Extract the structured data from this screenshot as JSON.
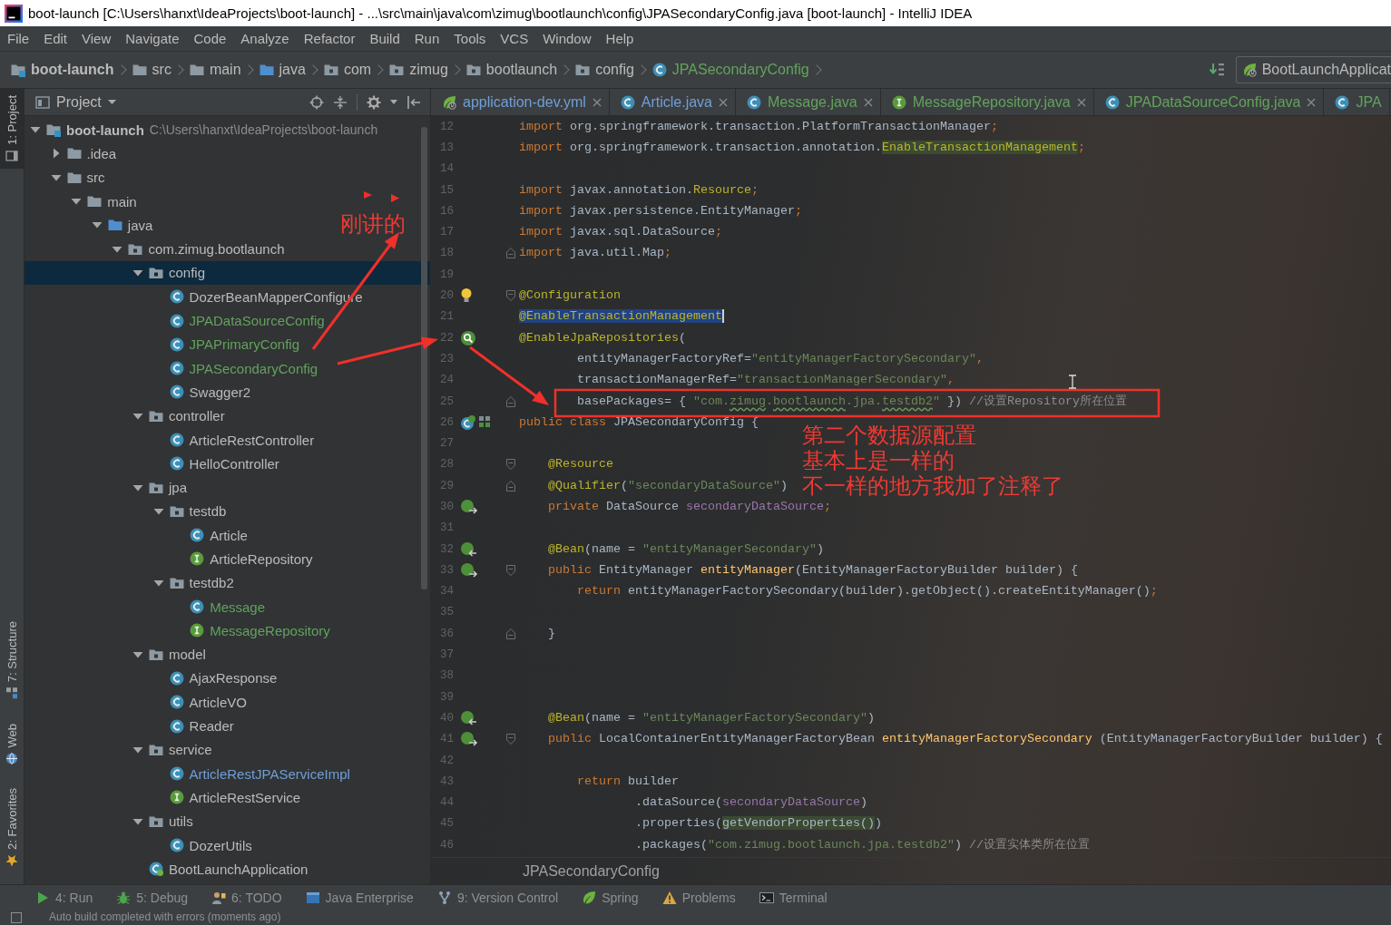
{
  "window": {
    "title": "boot-launch [C:\\Users\\hanxt\\IdeaProjects\\boot-launch] - ...\\src\\main\\java\\com\\zimug\\bootlaunch\\config\\JPASecondaryConfig.java [boot-launch] - IntelliJ IDEA"
  },
  "menu": [
    "File",
    "Edit",
    "View",
    "Navigate",
    "Code",
    "Analyze",
    "Refactor",
    "Build",
    "Run",
    "Tools",
    "VCS",
    "Window",
    "Help"
  ],
  "navigation_bar": {
    "crumbs": [
      {
        "kind": "module",
        "label": "boot-launch"
      },
      {
        "kind": "folder",
        "label": "src"
      },
      {
        "kind": "folder",
        "label": "main"
      },
      {
        "kind": "source-folder",
        "label": "java"
      },
      {
        "kind": "package",
        "label": "com"
      },
      {
        "kind": "package",
        "label": "zimug"
      },
      {
        "kind": "package",
        "label": "bootlaunch"
      },
      {
        "kind": "package",
        "label": "config"
      },
      {
        "kind": "class",
        "label": "JPASecondaryConfig",
        "color": "#62a35c"
      }
    ],
    "run_configuration": "BootLaunchApplicat"
  },
  "tool_strip": {
    "top": [
      {
        "kind": "project",
        "label": "1: Project",
        "selected": true
      }
    ],
    "bottom": [
      {
        "kind": "structure",
        "label": "7: Structure",
        "selected": false
      },
      {
        "kind": "web",
        "label": "Web",
        "selected": false
      },
      {
        "kind": "favorites",
        "label": "2: Favorites",
        "selected": false
      }
    ]
  },
  "project_panel": {
    "title": "Project",
    "tree": [
      {
        "kind": "module",
        "label": "boot-launch",
        "path": "C:\\Users\\hanxt\\IdeaProjects\\boot-launch",
        "expanded": true,
        "selected": false,
        "children": [
          {
            "kind": "folder",
            "label": ".idea",
            "expanded": false,
            "selected": false
          },
          {
            "kind": "folder",
            "label": "src",
            "expanded": true,
            "selected": false,
            "children": [
              {
                "kind": "folder",
                "label": "main",
                "expanded": true,
                "selected": false,
                "children": [
                  {
                    "kind": "source-folder",
                    "label": "java",
                    "expanded": true,
                    "selected": false,
                    "children": [
                      {
                        "kind": "package",
                        "label": "com.zimug.bootlaunch",
                        "expanded": true,
                        "selected": false,
                        "children": [
                          {
                            "kind": "package",
                            "label": "config",
                            "expanded": true,
                            "selected": true,
                            "children": [
                              {
                                "kind": "class",
                                "label": "DozerBeanMapperConfigure",
                                "color": "#bbbbbb",
                                "selected": false
                              },
                              {
                                "kind": "class",
                                "label": "JPADataSourceConfig",
                                "color": "#62a35c",
                                "selected": false
                              },
                              {
                                "kind": "class",
                                "label": "JPAPrimaryConfig",
                                "color": "#62a35c",
                                "selected": false
                              },
                              {
                                "kind": "class",
                                "label": "JPASecondaryConfig",
                                "color": "#62a35c",
                                "selected": false
                              },
                              {
                                "kind": "class",
                                "label": "Swagger2",
                                "color": "#bbbbbb",
                                "selected": false
                              }
                            ]
                          },
                          {
                            "kind": "package",
                            "label": "controller",
                            "expanded": true,
                            "selected": false,
                            "children": [
                              {
                                "kind": "class",
                                "label": "ArticleRestController",
                                "color": "#bbbbbb",
                                "selected": false
                              },
                              {
                                "kind": "class",
                                "label": "HelloController",
                                "color": "#bbbbbb",
                                "selected": false
                              }
                            ]
                          },
                          {
                            "kind": "package",
                            "label": "jpa",
                            "expanded": true,
                            "selected": false,
                            "children": [
                              {
                                "kind": "package",
                                "label": "testdb",
                                "expanded": true,
                                "selected": false,
                                "children": [
                                  {
                                    "kind": "class",
                                    "label": "Article",
                                    "color": "#bbbbbb",
                                    "selected": false
                                  },
                                  {
                                    "kind": "interface",
                                    "label": "ArticleRepository",
                                    "color": "#bbbbbb",
                                    "selected": false
                                  }
                                ]
                              },
                              {
                                "kind": "package",
                                "label": "testdb2",
                                "expanded": true,
                                "selected": false,
                                "children": [
                                  {
                                    "kind": "class",
                                    "label": "Message",
                                    "color": "#62a35c",
                                    "selected": false
                                  },
                                  {
                                    "kind": "interface",
                                    "label": "MessageRepository",
                                    "color": "#62a35c",
                                    "selected": false
                                  }
                                ]
                              }
                            ]
                          },
                          {
                            "kind": "package",
                            "label": "model",
                            "expanded": true,
                            "selected": false,
                            "children": [
                              {
                                "kind": "class",
                                "label": "AjaxResponse",
                                "color": "#bbbbbb",
                                "selected": false
                              },
                              {
                                "kind": "class",
                                "label": "ArticleVO",
                                "color": "#bbbbbb",
                                "selected": false
                              },
                              {
                                "kind": "class",
                                "label": "Reader",
                                "color": "#bbbbbb",
                                "selected": false
                              }
                            ]
                          },
                          {
                            "kind": "package",
                            "label": "service",
                            "expanded": true,
                            "selected": false,
                            "children": [
                              {
                                "kind": "class",
                                "label": "ArticleRestJPAServiceImpl",
                                "color": "#6f9fd8",
                                "selected": false
                              },
                              {
                                "kind": "interface",
                                "label": "ArticleRestService",
                                "color": "#bbbbbb",
                                "selected": false
                              }
                            ]
                          },
                          {
                            "kind": "package",
                            "label": "utils",
                            "expanded": true,
                            "selected": false,
                            "children": [
                              {
                                "kind": "class",
                                "label": "DozerUtils",
                                "color": "#bbbbbb",
                                "selected": false
                              }
                            ]
                          },
                          {
                            "kind": "boot-app",
                            "label": "BootLaunchApplication",
                            "color": "#bbbbbb",
                            "selected": false
                          }
                        ]
                      }
                    ]
                  }
                ]
              }
            ]
          }
        ]
      }
    ]
  },
  "editor": {
    "tabs": [
      {
        "kind": "yaml",
        "label": "application-dev.yml",
        "color": "#6f9fd8",
        "selected": false,
        "close_button": true
      },
      {
        "kind": "class",
        "label": "Article.java",
        "color": "#6f9fd8",
        "selected": false,
        "close_button": true
      },
      {
        "kind": "class",
        "label": "Message.java",
        "color": "#62a35c",
        "selected": false,
        "close_button": true
      },
      {
        "kind": "interface",
        "label": "MessageRepository.java",
        "color": "#62a35c",
        "selected": false,
        "close_button": true
      },
      {
        "kind": "class",
        "label": "JPADataSourceConfig.java",
        "color": "#62a35c",
        "selected": false,
        "close_button": true
      },
      {
        "kind": "class",
        "label": "JPA",
        "color": "#62a35c",
        "selected": false,
        "close_button": false
      }
    ],
    "lines": [
      {
        "number": "12",
        "tokens": [
          {
            "kind": "keyword",
            "text": "import "
          },
          {
            "kind": "plain",
            "text": "org.springframework.transaction.PlatformTransactionManager"
          },
          {
            "kind": "keyword",
            "text": ";"
          }
        ]
      },
      {
        "number": "13",
        "tokens": [
          {
            "kind": "keyword",
            "text": "import "
          },
          {
            "kind": "plain",
            "text": "org.springframework.transaction.annotation."
          },
          {
            "kind": "annotation",
            "text": "EnableTransactionManagement",
            "highlighted": true
          },
          {
            "kind": "keyword",
            "text": ";"
          }
        ]
      },
      {
        "number": "14"
      },
      {
        "number": "15",
        "tokens": [
          {
            "kind": "keyword",
            "text": "import "
          },
          {
            "kind": "plain",
            "text": "javax.annotation."
          },
          {
            "kind": "annotation",
            "text": "Resource"
          },
          {
            "kind": "keyword",
            "text": ";"
          }
        ]
      },
      {
        "number": "16",
        "tokens": [
          {
            "kind": "keyword",
            "text": "import "
          },
          {
            "kind": "plain",
            "text": "javax.persistence.EntityManager"
          },
          {
            "kind": "keyword",
            "text": ";"
          }
        ]
      },
      {
        "number": "17",
        "tokens": [
          {
            "kind": "keyword",
            "text": "import "
          },
          {
            "kind": "plain",
            "text": "javax.sql.DataSource"
          },
          {
            "kind": "keyword",
            "text": ";"
          }
        ]
      },
      {
        "number": "18",
        "fold_end": true,
        "tokens": [
          {
            "kind": "keyword",
            "text": "import "
          },
          {
            "kind": "plain",
            "text": "java.util.Map"
          },
          {
            "kind": "keyword",
            "text": ";"
          }
        ]
      },
      {
        "number": "19"
      },
      {
        "number": "20",
        "gutter_icon": {
          "kind": "bulb"
        },
        "fold_start": true,
        "tokens": [
          {
            "kind": "annotation",
            "text": "@Configuration"
          }
        ]
      },
      {
        "number": "21",
        "tokens": [
          {
            "kind": "annotation",
            "text": "@EnableTransactionManagement",
            "selected": true,
            "caret": true
          }
        ]
      },
      {
        "number": "22",
        "gutter_icon": {
          "kind": "bean-search"
        },
        "tokens": [
          {
            "kind": "annotation",
            "text": "@EnableJpaRepositories"
          },
          {
            "kind": "plain",
            "text": "("
          }
        ]
      },
      {
        "number": "23",
        "tokens": [
          {
            "kind": "plain",
            "text": "        entityManagerFactoryRef="
          },
          {
            "kind": "string",
            "text": "\"entityManagerFactorySecondary\""
          },
          {
            "kind": "keyword",
            "text": ","
          }
        ]
      },
      {
        "number": "24",
        "tokens": [
          {
            "kind": "plain",
            "text": "        transactionManagerRef="
          },
          {
            "kind": "string",
            "text": "\"transactionManagerSecondary\""
          },
          {
            "kind": "keyword",
            "text": ","
          }
        ]
      },
      {
        "number": "25",
        "fold_end": true,
        "tokens": [
          {
            "kind": "plain",
            "text": "        basePackages= { "
          },
          {
            "kind": "string",
            "text": "\"com."
          },
          {
            "kind": "string",
            "text": "zimug",
            "typo": true
          },
          {
            "kind": "string",
            "text": "."
          },
          {
            "kind": "string",
            "text": "bootlaunch",
            "typo": true
          },
          {
            "kind": "string",
            "text": ".jpa."
          },
          {
            "kind": "string",
            "text": "testdb2",
            "typo": true
          },
          {
            "kind": "string",
            "text": "\""
          },
          {
            "kind": "plain",
            "text": " }) "
          },
          {
            "kind": "comment",
            "text": "//设置Repository所在位置"
          }
        ]
      },
      {
        "number": "26",
        "gutter_icon": {
          "kind": "bean-class"
        },
        "tokens": [
          {
            "kind": "keyword",
            "text": "public class "
          },
          {
            "kind": "plain",
            "text": "JPASecondaryConfig {"
          }
        ]
      },
      {
        "number": "27"
      },
      {
        "number": "28",
        "fold_start": true,
        "tokens": [
          {
            "kind": "annotation",
            "text": "    @Resource"
          }
        ]
      },
      {
        "number": "29",
        "fold_end": true,
        "tokens": [
          {
            "kind": "annotation",
            "text": "    @Qualifier"
          },
          {
            "kind": "plain",
            "text": "("
          },
          {
            "kind": "string",
            "text": "\"secondaryDataSource\""
          },
          {
            "kind": "plain",
            "text": ")"
          }
        ]
      },
      {
        "number": "30",
        "gutter_icon": {
          "kind": "bean-out"
        },
        "tokens": [
          {
            "kind": "keyword",
            "text": "    private "
          },
          {
            "kind": "plain",
            "text": "DataSource "
          },
          {
            "kind": "field",
            "text": "secondaryDataSource"
          },
          {
            "kind": "keyword",
            "text": ";"
          }
        ]
      },
      {
        "number": "31"
      },
      {
        "number": "32",
        "gutter_icon": {
          "kind": "bean-in"
        },
        "tokens": [
          {
            "kind": "annotation",
            "text": "    @Bean"
          },
          {
            "kind": "plain",
            "text": "(name = "
          },
          {
            "kind": "string",
            "text": "\"entityManagerSecondary\""
          },
          {
            "kind": "plain",
            "text": ")"
          }
        ]
      },
      {
        "number": "33",
        "gutter_icon": {
          "kind": "bean-out"
        },
        "fold_start": true,
        "tokens": [
          {
            "kind": "keyword",
            "text": "    public "
          },
          {
            "kind": "plain",
            "text": "EntityManager "
          },
          {
            "kind": "method",
            "text": "entityManager"
          },
          {
            "kind": "plain",
            "text": "(EntityManagerFactoryBuilder builder) {"
          }
        ]
      },
      {
        "number": "34",
        "tokens": [
          {
            "kind": "keyword",
            "text": "        return "
          },
          {
            "kind": "plain",
            "text": "entityManagerFactorySecondary(builder).getObject().createEntityManager()"
          },
          {
            "kind": "keyword",
            "text": ";"
          }
        ]
      },
      {
        "number": "35"
      },
      {
        "number": "36",
        "fold_end": true,
        "tokens": [
          {
            "kind": "plain",
            "text": "    }"
          }
        ]
      },
      {
        "number": "37"
      },
      {
        "number": "38"
      },
      {
        "number": "39"
      },
      {
        "number": "40",
        "gutter_icon": {
          "kind": "bean-in"
        },
        "tokens": [
          {
            "kind": "annotation",
            "text": "    @Bean"
          },
          {
            "kind": "plain",
            "text": "(name = "
          },
          {
            "kind": "string",
            "text": "\"entityManagerFactorySecondary\""
          },
          {
            "kind": "plain",
            "text": ")"
          }
        ]
      },
      {
        "number": "41",
        "gutter_icon": {
          "kind": "bean-out"
        },
        "fold_start": true,
        "tokens": [
          {
            "kind": "keyword",
            "text": "    public "
          },
          {
            "kind": "plain",
            "text": "LocalContainerEntityManagerFactoryBean "
          },
          {
            "kind": "method",
            "text": "entityManagerFactorySecondary"
          },
          {
            "kind": "plain",
            "text": " (EntityManagerFactoryBuilder builder) {"
          }
        ]
      },
      {
        "number": "42"
      },
      {
        "number": "43",
        "tokens": [
          {
            "kind": "keyword",
            "text": "        return "
          },
          {
            "kind": "plain",
            "text": "builder"
          }
        ]
      },
      {
        "number": "44",
        "tokens": [
          {
            "kind": "plain",
            "text": "                .dataSource("
          },
          {
            "kind": "field",
            "text": "secondaryDataSource"
          },
          {
            "kind": "plain",
            "text": ")"
          }
        ]
      },
      {
        "number": "45",
        "tokens": [
          {
            "kind": "plain",
            "text": "                .properties("
          },
          {
            "kind": "plain",
            "text": "getVendorProperties()",
            "highlighted": true
          },
          {
            "kind": "plain",
            "text": ")"
          }
        ]
      },
      {
        "number": "46",
        "tokens": [
          {
            "kind": "plain",
            "text": "                .packages("
          },
          {
            "kind": "string",
            "text": "\"com.zimug.bootlaunch.jpa.testdb2\""
          },
          {
            "kind": "plain",
            "text": ") "
          },
          {
            "kind": "comment",
            "text": "//设置实体类所在位置"
          }
        ]
      }
    ],
    "breadcrumb": "JPASecondaryConfig"
  },
  "tool_windows": [
    {
      "kind": "run",
      "label": "4: Run"
    },
    {
      "kind": "debug",
      "label": "5: Debug"
    },
    {
      "kind": "todo",
      "label": "6: TODO"
    },
    {
      "kind": "java-enterprise",
      "label": "Java Enterprise"
    },
    {
      "kind": "version-control",
      "label": "9: Version Control"
    },
    {
      "kind": "spring",
      "label": "Spring"
    },
    {
      "kind": "problems",
      "label": "Problems"
    },
    {
      "kind": "terminal",
      "label": "Terminal"
    }
  ],
  "status_bar": {
    "message": "Auto build completed with errors (moments ago)"
  },
  "annotations": {
    "label": "刚讲的",
    "note": [
      "第二个数据源配置",
      "基本上是一样的",
      "不一样的地方我加了注释了"
    ]
  }
}
